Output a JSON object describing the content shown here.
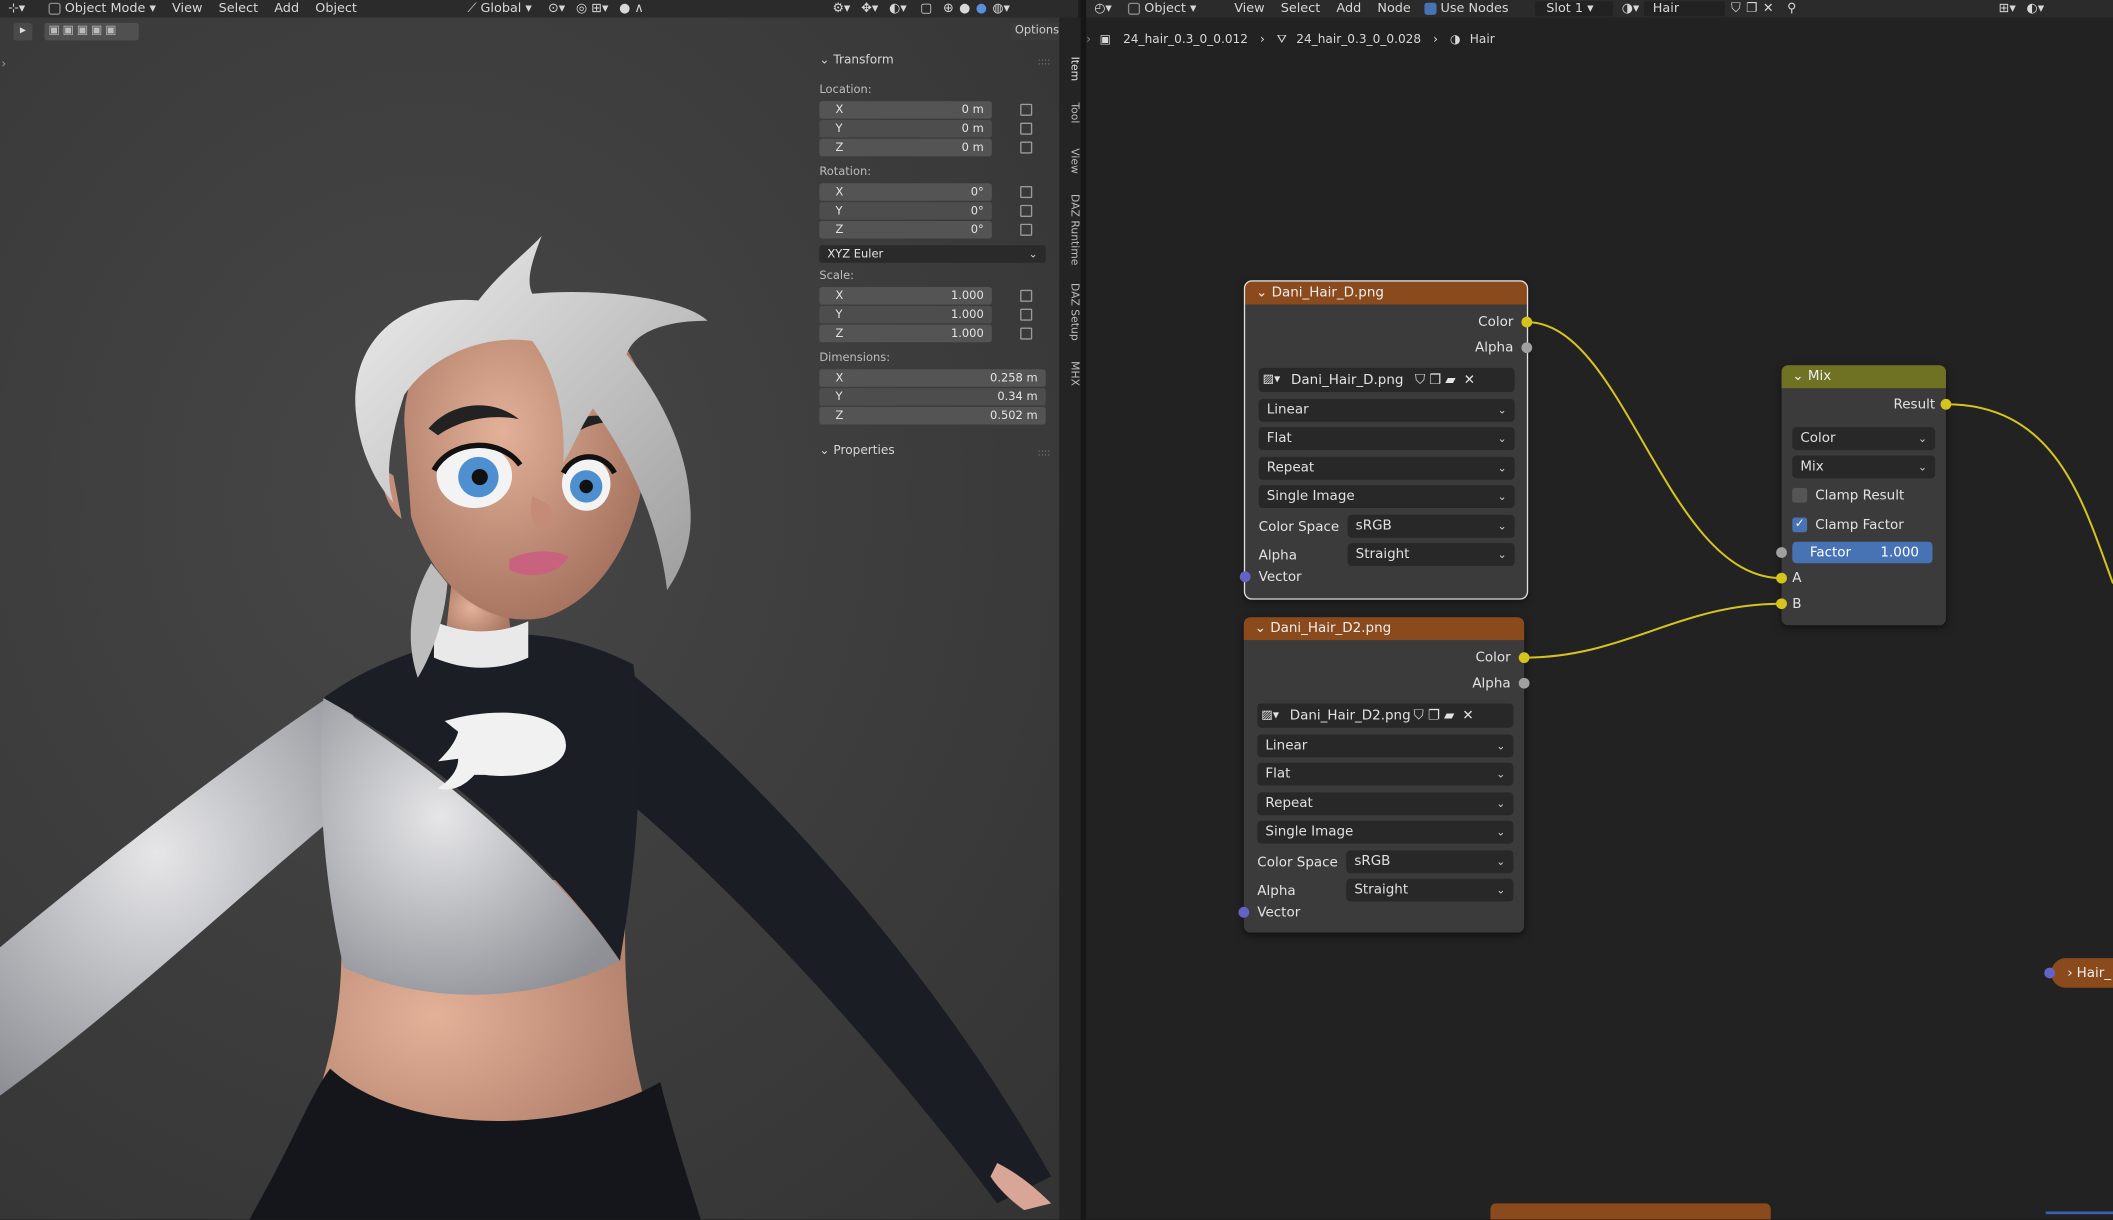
{
  "viewport_header": {
    "mode": "Object Mode",
    "menus": [
      "View",
      "Select",
      "Add",
      "Object"
    ],
    "orientation": "Global"
  },
  "options_label": "Options",
  "transform": {
    "title": "Transform",
    "location": {
      "label": "Location:",
      "x": "0 m",
      "y": "0 m",
      "z": "0 m"
    },
    "rotation": {
      "label": "Rotation:",
      "x": "0°",
      "y": "0°",
      "z": "0°"
    },
    "rotation_mode": "XYZ Euler",
    "scale": {
      "label": "Scale:",
      "x": "1.000",
      "y": "1.000",
      "z": "1.000"
    },
    "dimensions": {
      "label": "Dimensions:",
      "x": "0.258 m",
      "y": "0.34 m",
      "z": "0.502 m"
    },
    "axis": {
      "x": "X",
      "y": "Y",
      "z": "Z"
    }
  },
  "properties_title": "Properties",
  "side_tabs": [
    "Item",
    "Tool",
    "View",
    "DAZ Runtime",
    "DAZ Setup",
    "MHX"
  ],
  "node_header": {
    "type": "Object",
    "menus": [
      "View",
      "Select",
      "Add",
      "Node"
    ],
    "use_nodes": "Use Nodes",
    "slot": "Slot 1",
    "material": "Hair"
  },
  "breadcrumb": [
    "24_hair_0.3_0_0.012",
    "24_hair_0.3_0_0.028",
    "Hair"
  ],
  "nodes": [
    {
      "title": "Dani_Hair_D.png",
      "color_out": "Color",
      "alpha_out": "Alpha",
      "image": "Dani_Hair_D.png",
      "interpolation": "Linear",
      "projection": "Flat",
      "extension": "Repeat",
      "source": "Single Image",
      "cs_label": "Color Space",
      "cs_value": "sRGB",
      "alpha_label": "Alpha",
      "alpha_value": "Straight",
      "vector_in": "Vector"
    },
    {
      "title": "Dani_Hair_D2.png",
      "color_out": "Color",
      "alpha_out": "Alpha",
      "image": "Dani_Hair_D2.png",
      "interpolation": "Linear",
      "projection": "Flat",
      "extension": "Repeat",
      "source": "Single Image",
      "cs_label": "Color Space",
      "cs_value": "sRGB",
      "alpha_label": "Alpha",
      "alpha_value": "Straight",
      "vector_in": "Vector"
    }
  ],
  "mix": {
    "title": "Mix",
    "result": "Result",
    "data_type": "Color",
    "blend": "Mix",
    "clamp_result": "Clamp Result",
    "clamp_factor": "Clamp Factor",
    "factor_label": "Factor",
    "factor_value": "1.000",
    "a": "A",
    "b": "B"
  },
  "partial_node": "Hair_",
  "colors": {
    "image_header": "#8a4a1c",
    "mix_header": "#6f7222",
    "link": "#d6c41e",
    "factor": "#4772b3"
  }
}
